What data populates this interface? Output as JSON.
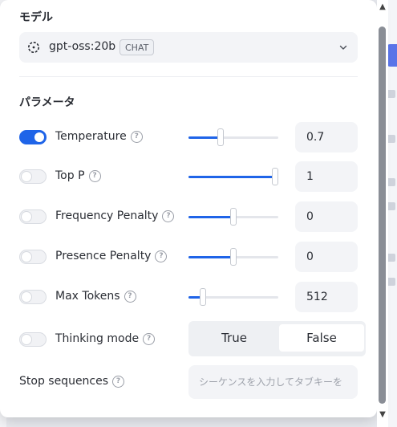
{
  "model_section": {
    "title": "モデル",
    "selected_model": "gpt-oss:20b",
    "badge": "CHAT"
  },
  "params_section": {
    "title": "パラメータ",
    "params": [
      {
        "label": "Temperature",
        "enabled": true,
        "value": "0.7",
        "slider_fraction": 0.36
      },
      {
        "label": "Top P",
        "enabled": false,
        "value": "1",
        "slider_fraction": 0.96
      },
      {
        "label": "Frequency Penalty",
        "enabled": false,
        "value": "0",
        "slider_fraction": 0.5
      },
      {
        "label": "Presence Penalty",
        "enabled": false,
        "value": "0",
        "slider_fraction": 0.5
      },
      {
        "label": "Max Tokens",
        "enabled": false,
        "value": "512",
        "slider_fraction": 0.16
      }
    ],
    "thinking_mode": {
      "label": "Thinking mode",
      "enabled": false,
      "options": [
        "True",
        "False"
      ],
      "selected": "False"
    },
    "stop_sequences": {
      "label": "Stop sequences",
      "placeholder": "シーケンスを入力してタブキーを"
    }
  },
  "colors": {
    "accent": "#1f64e8",
    "panel": "#ffffff",
    "input_bg": "#f3f4f7"
  }
}
